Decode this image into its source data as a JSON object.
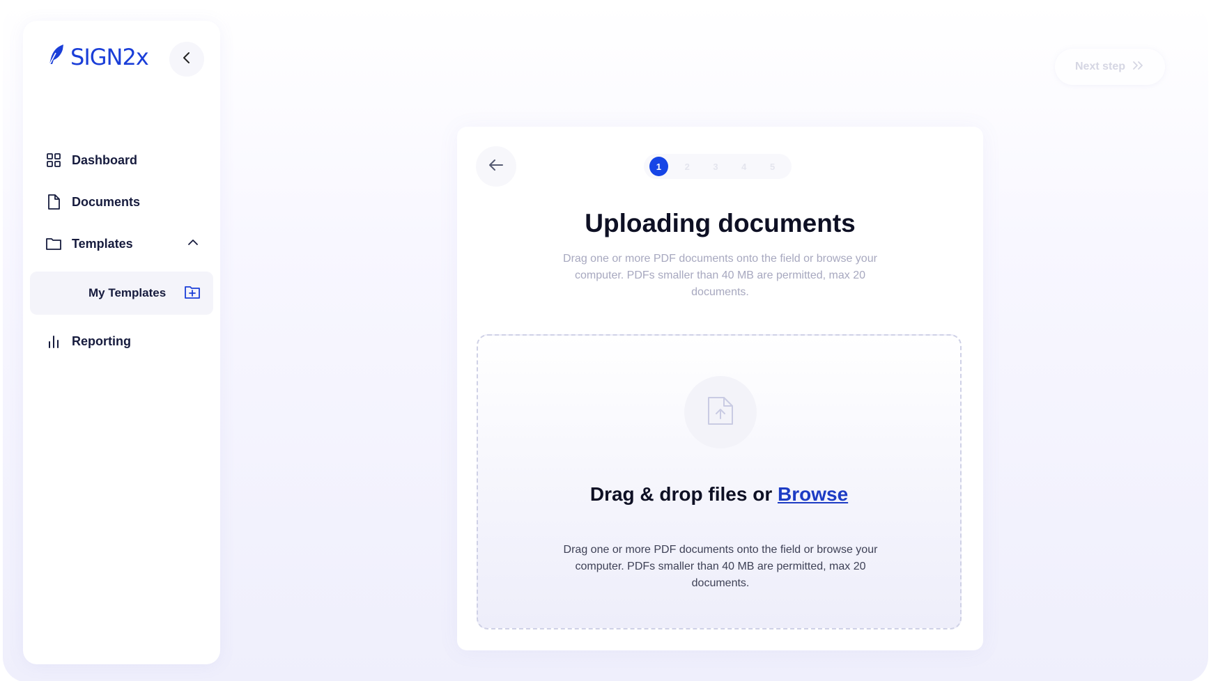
{
  "brand": {
    "name": "SIGN2x",
    "color": "#1a3ed8"
  },
  "sidebar": {
    "items": [
      {
        "label": "Dashboard",
        "icon": "grid-icon"
      },
      {
        "label": "Documents",
        "icon": "document-icon"
      },
      {
        "label": "Templates",
        "icon": "folder-icon",
        "expanded": true,
        "children": [
          {
            "label": "My Templates",
            "icon": "folder-plus-icon",
            "active": true
          }
        ]
      },
      {
        "label": "Reporting",
        "icon": "bar-chart-icon"
      }
    ]
  },
  "header": {
    "next_step_label": "Next step"
  },
  "wizard": {
    "steps": [
      "1",
      "2",
      "3",
      "4",
      "5"
    ],
    "current_step": 1,
    "title": "Uploading documents",
    "description": "Drag one or more PDF documents onto the field or browse your computer. PDFs smaller than 40 MB are permitted, max 20 documents."
  },
  "dropzone": {
    "title_prefix": "Drag & drop files or ",
    "browse_label": "Browse",
    "description": "Drag one or more PDF documents onto the field or browse your computer. PDFs smaller than 40 MB are permitted, max 20 documents."
  },
  "colors": {
    "accent": "#1645e6",
    "link": "#1d3cc4",
    "text_dark": "#0e1024"
  }
}
